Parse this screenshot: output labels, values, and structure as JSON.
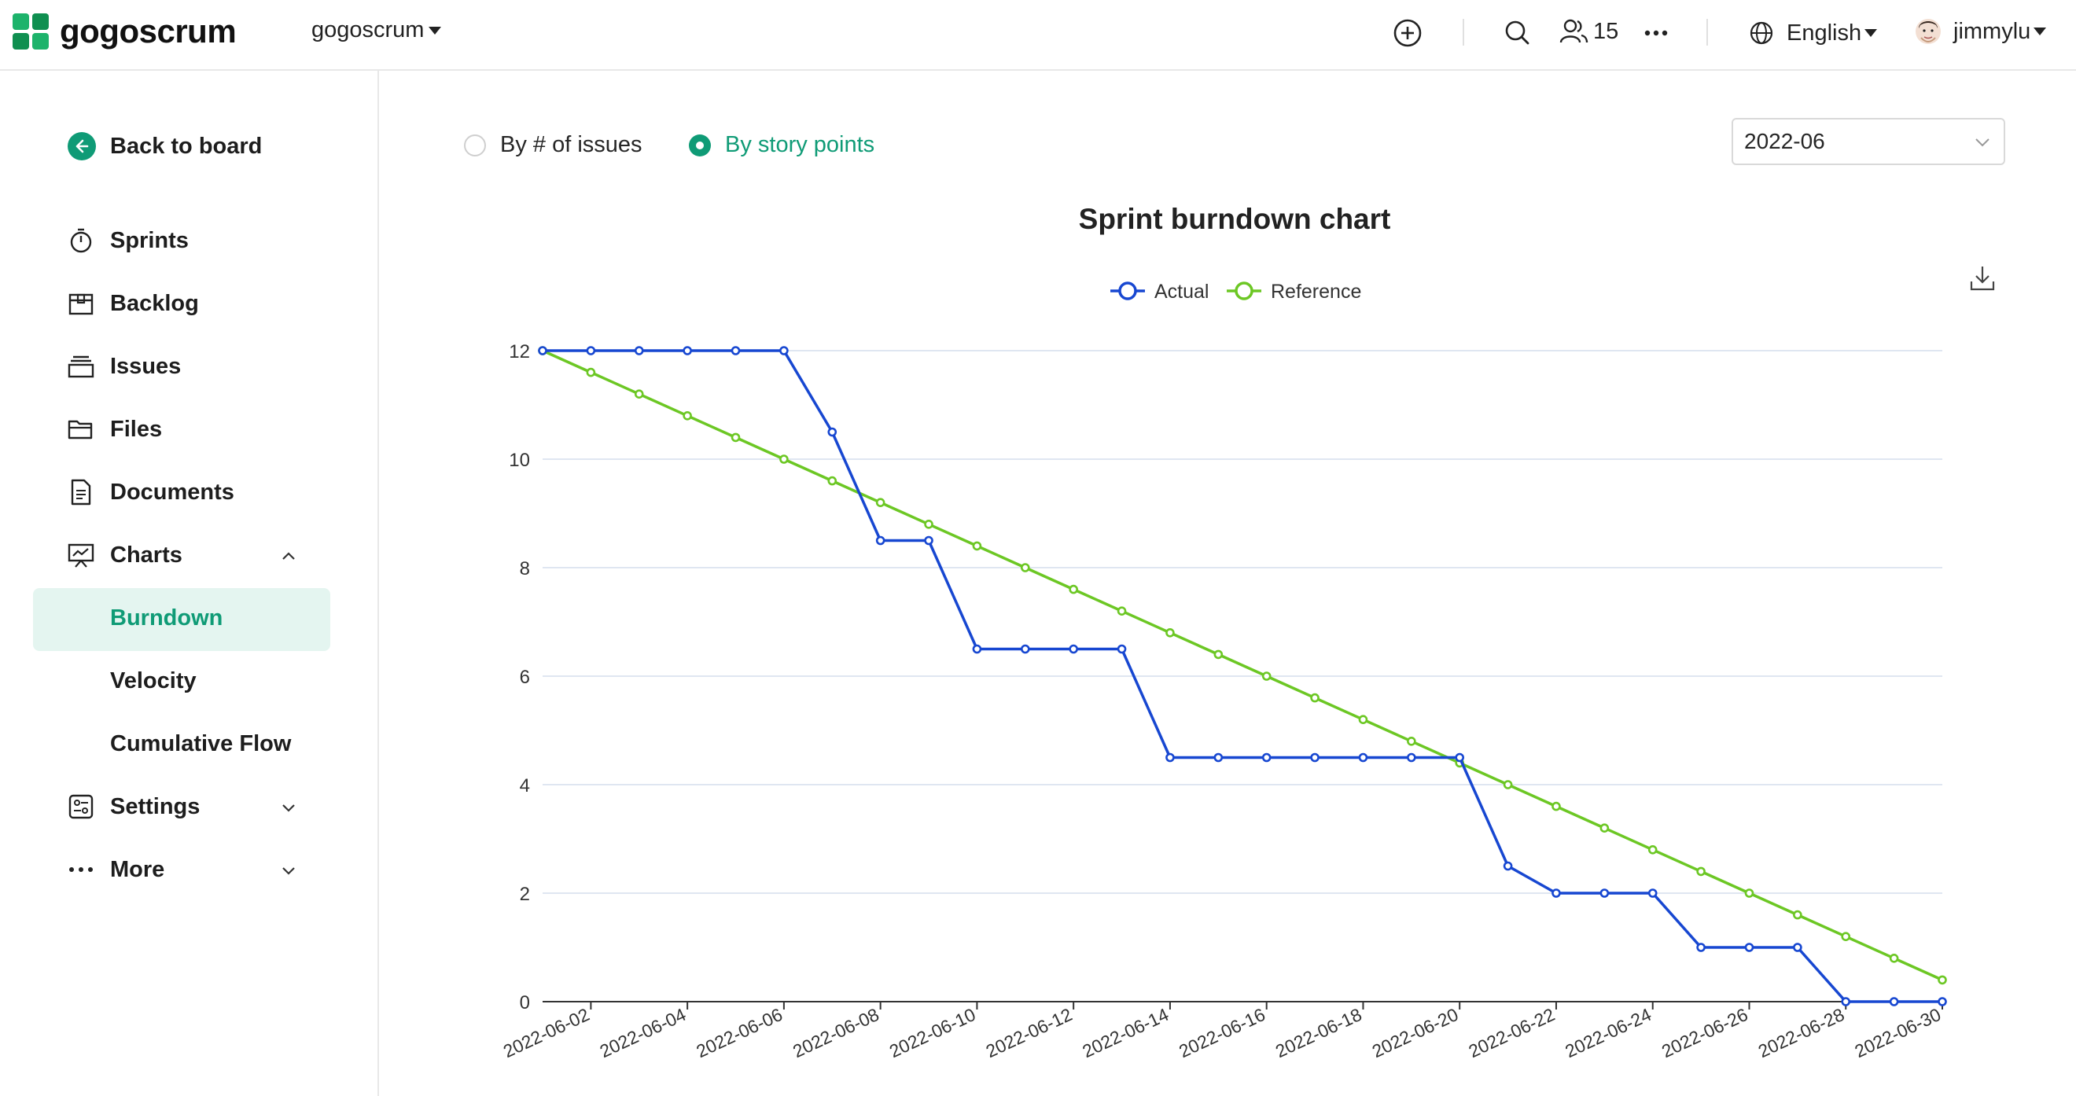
{
  "app": {
    "brand": "gogoscrum",
    "project": "gogoscrum"
  },
  "header": {
    "member_count": "15",
    "language": "English",
    "username": "jimmylu",
    "icons": [
      "plus-circle-icon",
      "search-icon",
      "members-icon",
      "more-icon",
      "globe-icon",
      "avatar"
    ]
  },
  "sidebar": {
    "back_label": "Back to board",
    "items": [
      {
        "label": "Sprints",
        "icon": "stopwatch-icon"
      },
      {
        "label": "Backlog",
        "icon": "box-icon"
      },
      {
        "label": "Issues",
        "icon": "stack-icon"
      },
      {
        "label": "Files",
        "icon": "folder-icon"
      },
      {
        "label": "Documents",
        "icon": "document-icon"
      },
      {
        "label": "Charts",
        "icon": "presentation-chart-icon",
        "expanded": true
      },
      {
        "label": "Settings",
        "icon": "settings-icon",
        "expanded": false
      },
      {
        "label": "More",
        "icon": "dots-icon",
        "expanded": false
      }
    ],
    "charts_sub": [
      {
        "label": "Burndown",
        "active": true
      },
      {
        "label": "Velocity",
        "active": false
      },
      {
        "label": "Cumulative Flow",
        "active": false
      }
    ]
  },
  "main": {
    "radio_issues": "By # of issues",
    "radio_points": "By story points",
    "selected_mode": "story_points",
    "month": "2022-06"
  },
  "colors": {
    "accent": "#0f9b76",
    "actual": "#1747d1",
    "reference": "#6cc724",
    "active_bg": "#e4f5f0"
  },
  "chart_data": {
    "type": "line",
    "title": "Sprint burndown chart",
    "legend_position": "top-center",
    "grid": true,
    "x": [
      "2022-06-01",
      "2022-06-02",
      "2022-06-03",
      "2022-06-04",
      "2022-06-05",
      "2022-06-06",
      "2022-06-07",
      "2022-06-08",
      "2022-06-09",
      "2022-06-10",
      "2022-06-11",
      "2022-06-12",
      "2022-06-13",
      "2022-06-14",
      "2022-06-15",
      "2022-06-16",
      "2022-06-17",
      "2022-06-18",
      "2022-06-19",
      "2022-06-20",
      "2022-06-21",
      "2022-06-22",
      "2022-06-23",
      "2022-06-24",
      "2022-06-25",
      "2022-06-26",
      "2022-06-27",
      "2022-06-28",
      "2022-06-29",
      "2022-06-30"
    ],
    "x_tick_labels": [
      "2022-06-02",
      "2022-06-04",
      "2022-06-06",
      "2022-06-08",
      "2022-06-10",
      "2022-06-12",
      "2022-06-14",
      "2022-06-16",
      "2022-06-18",
      "2022-06-20",
      "2022-06-22",
      "2022-06-24",
      "2022-06-26",
      "2022-06-28",
      "2022-06-30"
    ],
    "y_ticks": [
      0,
      2,
      4,
      6,
      8,
      10,
      12
    ],
    "ylim": [
      0,
      12
    ],
    "series": [
      {
        "name": "Actual",
        "color": "#1747d1",
        "values": [
          12,
          12,
          12,
          12,
          12,
          12,
          10.5,
          8.5,
          8.5,
          6.5,
          6.5,
          6.5,
          6.5,
          4.5,
          4.5,
          4.5,
          4.5,
          4.5,
          4.5,
          4.5,
          2.5,
          2,
          2,
          2,
          1,
          1,
          1,
          0,
          0,
          0
        ]
      },
      {
        "name": "Reference",
        "color": "#6cc724",
        "values": [
          12,
          11.6,
          11.2,
          10.8,
          10.4,
          10,
          9.6,
          9.2,
          8.8,
          8.4,
          8,
          7.6,
          7.2,
          6.8,
          6.4,
          6,
          5.6,
          5.2,
          4.8,
          4.4,
          4,
          3.6,
          3.2,
          2.8,
          2.4,
          2,
          1.6,
          1.2,
          0.8,
          0.4
        ]
      }
    ]
  }
}
